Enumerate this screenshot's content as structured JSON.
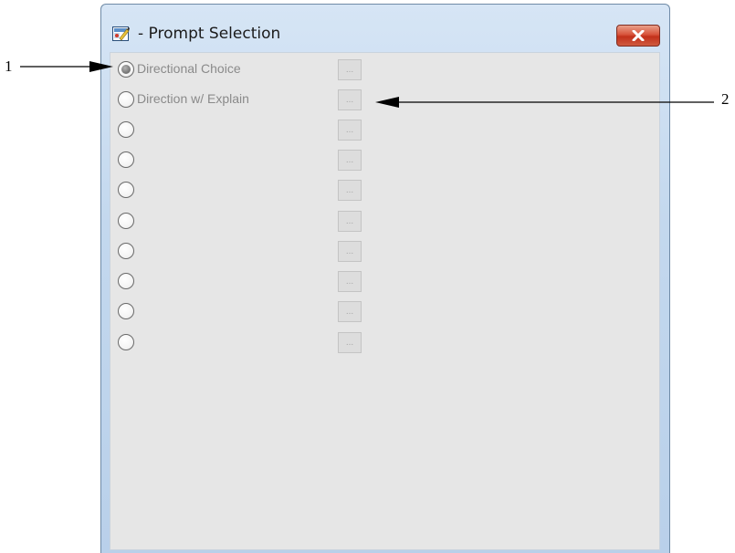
{
  "window": {
    "title": "- Prompt Selection",
    "close_icon": "close-x-icon",
    "app_icon": "prompt-app-icon"
  },
  "options": [
    {
      "label": "Directional Choice",
      "selected": true,
      "button_label": "..."
    },
    {
      "label": "Direction w/ Explain",
      "selected": false,
      "button_label": "..."
    },
    {
      "label": "",
      "selected": false,
      "button_label": "..."
    },
    {
      "label": "",
      "selected": false,
      "button_label": "..."
    },
    {
      "label": "",
      "selected": false,
      "button_label": "..."
    },
    {
      "label": "",
      "selected": false,
      "button_label": "..."
    },
    {
      "label": "",
      "selected": false,
      "button_label": "..."
    },
    {
      "label": "",
      "selected": false,
      "button_label": "..."
    },
    {
      "label": "",
      "selected": false,
      "button_label": "..."
    },
    {
      "label": "",
      "selected": false,
      "button_label": "..."
    }
  ],
  "callouts": {
    "one": "1",
    "two": "2"
  },
  "colors": {
    "close_button": "#c2301a",
    "disabled_text": "#8a8a8a",
    "client_background": "#e6e6e6"
  }
}
